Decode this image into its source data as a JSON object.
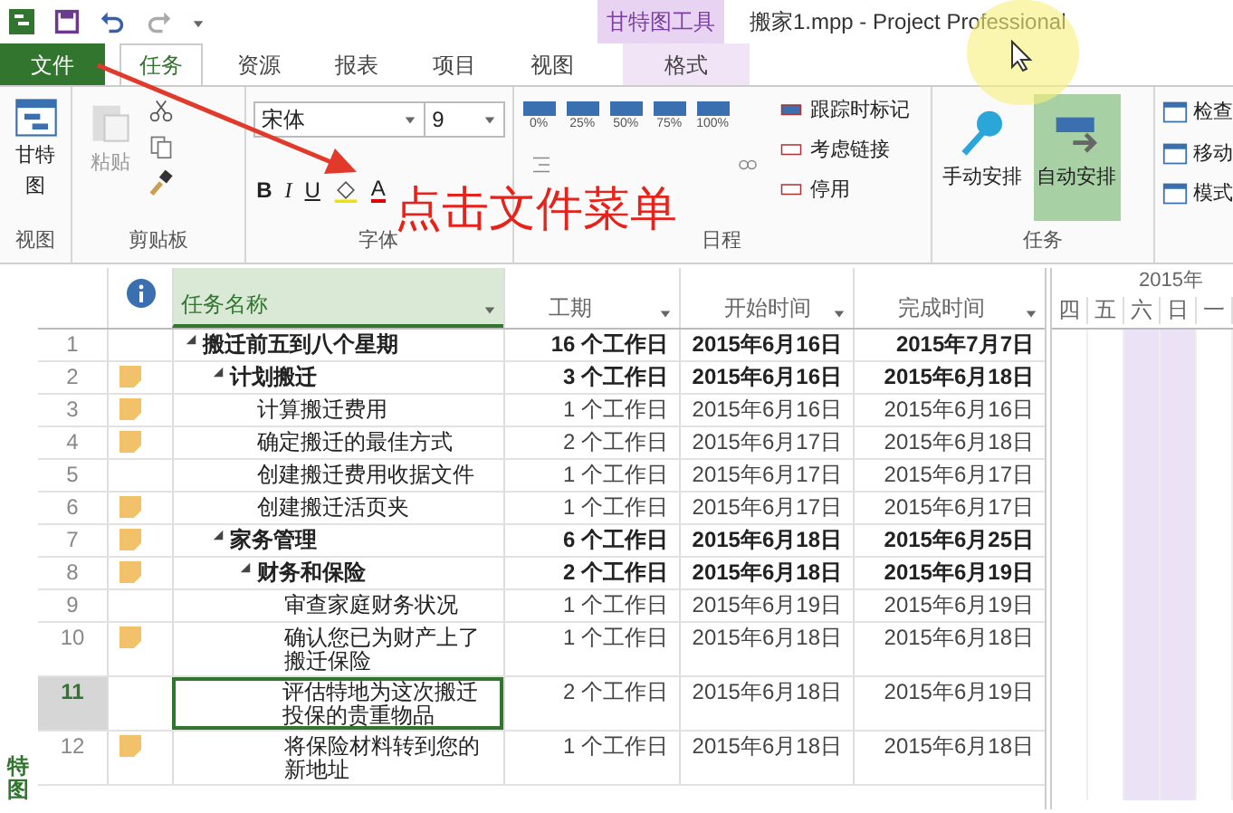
{
  "window": {
    "title": "搬家1.mpp - Project Professional"
  },
  "context_group": {
    "label": "甘特图工具"
  },
  "tabs": [
    {
      "label": "文件",
      "kind": "file",
      "selected": false
    },
    {
      "label": "任务",
      "kind": "tab",
      "selected": true
    },
    {
      "label": "资源",
      "kind": "tab",
      "selected": false
    },
    {
      "label": "报表",
      "kind": "tab",
      "selected": false
    },
    {
      "label": "项目",
      "kind": "tab",
      "selected": false
    },
    {
      "label": "视图",
      "kind": "tab",
      "selected": false
    },
    {
      "label": "格式",
      "kind": "context",
      "selected": false
    }
  ],
  "ribbon": {
    "view_group": {
      "label": "视图",
      "button": "甘特图"
    },
    "clipboard_group": {
      "label": "剪贴板",
      "paste": "粘贴"
    },
    "font_group": {
      "label": "字体",
      "font": "宋体",
      "size": "9",
      "bold": "B",
      "italic": "I",
      "underline": "U",
      "font_color": "A"
    },
    "schedule_group": {
      "label": "日程",
      "percent_buttons": [
        "0%",
        "25%",
        "50%",
        "75%",
        "100%"
      ],
      "items": [
        "跟踪时标记",
        "考虑链接",
        "停用"
      ]
    },
    "task_group": {
      "label": "任务",
      "buttons": [
        {
          "label": "手动安排",
          "selected": false
        },
        {
          "label": "自动安排",
          "selected": true
        }
      ],
      "items": [
        "检查",
        "移动",
        "模式"
      ]
    }
  },
  "side_label": "特图",
  "table": {
    "columns": [
      {
        "label": "任务名称"
      },
      {
        "label": "工期"
      },
      {
        "label": "开始时间"
      },
      {
        "label": "完成时间"
      }
    ],
    "tasks": [
      {
        "number": "1",
        "note": false,
        "name": "搬迁前五到八个星期",
        "duration": "16 个工作日",
        "start": "2015年6月16日",
        "finish": "2015年7月7日",
        "selected": false,
        "expanded": true,
        "children": [
          {
            "number": "2",
            "note": true,
            "name": "计划搬迁",
            "duration": "3 个工作日",
            "start": "2015年6月16日",
            "finish": "2015年6月18日",
            "selected": false,
            "expanded": true,
            "children": [
              {
                "number": "3",
                "note": true,
                "name": "计算搬迁费用",
                "duration": "1 个工作日",
                "start": "2015年6月16日",
                "finish": "2015年6月16日",
                "selected": false
              },
              {
                "number": "4",
                "note": true,
                "name": "确定搬迁的最佳方式",
                "duration": "2 个工作日",
                "start": "2015年6月17日",
                "finish": "2015年6月18日",
                "selected": false
              },
              {
                "number": "5",
                "note": false,
                "name": "创建搬迁费用收据文件",
                "duration": "1 个工作日",
                "start": "2015年6月17日",
                "finish": "2015年6月17日",
                "selected": false
              },
              {
                "number": "6",
                "note": true,
                "name": "创建搬迁活页夹",
                "duration": "1 个工作日",
                "start": "2015年6月17日",
                "finish": "2015年6月17日",
                "selected": false
              }
            ]
          },
          {
            "number": "7",
            "note": true,
            "name": "家务管理",
            "duration": "6 个工作日",
            "start": "2015年6月18日",
            "finish": "2015年6月25日",
            "selected": false,
            "expanded": true,
            "children": [
              {
                "number": "8",
                "note": true,
                "name": "财务和保险",
                "duration": "2 个工作日",
                "start": "2015年6月18日",
                "finish": "2015年6月19日",
                "selected": false,
                "expanded": true,
                "children": [
                  {
                    "number": "9",
                    "note": false,
                    "name": "审查家庭财务状况",
                    "duration": "1 个工作日",
                    "start": "2015年6月19日",
                    "finish": "2015年6月19日",
                    "selected": false
                  },
                  {
                    "number": "10",
                    "note": true,
                    "name": "确认您已为财产上了搬迁保险",
                    "duration": "1 个工作日",
                    "start": "2015年6月18日",
                    "finish": "2015年6月18日",
                    "selected": false
                  },
                  {
                    "number": "11",
                    "note": false,
                    "name": "评估特地为这次搬迁投保的贵重物品",
                    "duration": "2 个工作日",
                    "start": "2015年6月18日",
                    "finish": "2015年6月19日",
                    "selected": true
                  },
                  {
                    "number": "12",
                    "note": true,
                    "name": "将保险材料转到您的新地址",
                    "duration": "1 个工作日",
                    "start": "2015年6月18日",
                    "finish": "2015年6月18日",
                    "selected": false
                  }
                ]
              }
            ]
          }
        ]
      }
    ]
  },
  "gantt": {
    "period": "2015年",
    "days": [
      {
        "label": "四",
        "weekend": false
      },
      {
        "label": "五",
        "weekend": false
      },
      {
        "label": "六",
        "weekend": true
      },
      {
        "label": "日",
        "weekend": true
      },
      {
        "label": "一",
        "weekend": false
      }
    ]
  },
  "annotation": {
    "text": "点击文件菜单"
  }
}
